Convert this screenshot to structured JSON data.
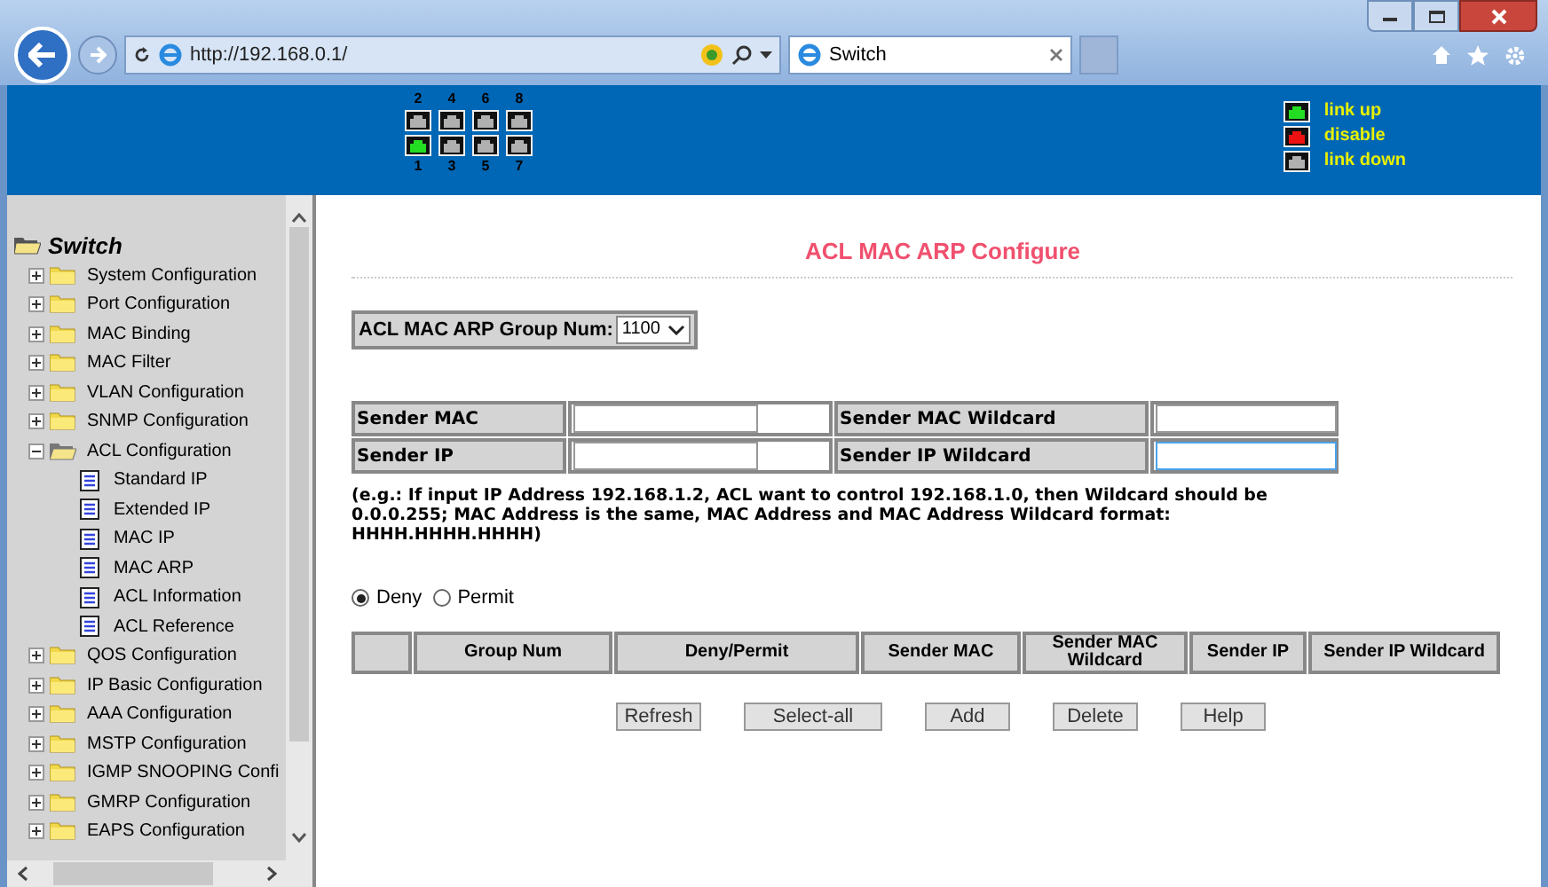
{
  "browser": {
    "url": "http://192.168.0.1/",
    "tab_title": "Switch"
  },
  "ports": {
    "top": [
      {
        "label": "2",
        "color": "#b0b0b0"
      },
      {
        "label": "4",
        "color": "#b0b0b0"
      },
      {
        "label": "6",
        "color": "#b0b0b0"
      },
      {
        "label": "8",
        "color": "#b0b0b0"
      }
    ],
    "bottom": [
      {
        "label": "1",
        "color": "#22dd22"
      },
      {
        "label": "3",
        "color": "#b0b0b0"
      },
      {
        "label": "5",
        "color": "#b0b0b0"
      },
      {
        "label": "7",
        "color": "#b0b0b0"
      }
    ]
  },
  "legend": [
    {
      "label": "link up",
      "color": "#22dd22"
    },
    {
      "label": "disable",
      "color": "#ee1111"
    },
    {
      "label": "link down",
      "color": "#b0b0b0"
    }
  ],
  "sidebar": {
    "root": "Switch",
    "items": [
      {
        "label": "System Configuration",
        "expanded": false
      },
      {
        "label": "Port Configuration",
        "expanded": false
      },
      {
        "label": "MAC Binding",
        "expanded": false
      },
      {
        "label": "MAC Filter",
        "expanded": false
      },
      {
        "label": "VLAN Configuration",
        "expanded": false
      },
      {
        "label": "SNMP Configuration",
        "expanded": false
      },
      {
        "label": "ACL Configuration",
        "expanded": true,
        "children": [
          {
            "label": "Standard IP"
          },
          {
            "label": "Extended IP"
          },
          {
            "label": "MAC IP"
          },
          {
            "label": "MAC ARP"
          },
          {
            "label": "ACL Information"
          },
          {
            "label": "ACL Reference"
          }
        ]
      },
      {
        "label": "QOS Configuration",
        "expanded": false
      },
      {
        "label": "IP Basic Configuration",
        "expanded": false
      },
      {
        "label": "AAA Configuration",
        "expanded": false
      },
      {
        "label": "MSTP Configuration",
        "expanded": false
      },
      {
        "label": "IGMP SNOOPING Confi",
        "expanded": false
      },
      {
        "label": "GMRP Configuration",
        "expanded": false
      },
      {
        "label": "EAPS Configuration",
        "expanded": false
      }
    ]
  },
  "form": {
    "title": "ACL MAC ARP Configure",
    "group_num": {
      "label": "ACL MAC ARP Group Num:",
      "value": "1100"
    },
    "fields": [
      {
        "label": "Sender MAC",
        "focused": false
      },
      {
        "label": "Sender MAC Wildcard",
        "focused": false
      },
      {
        "label": "Sender IP",
        "focused": false
      },
      {
        "label": "Sender IP Wildcard",
        "focused": true
      }
    ],
    "note": "(e.g.: If input IP Address 192.168.1.2, ACL want to control 192.168.1.0, then Wildcard should be 0.0.0.255; MAC Address is the same, MAC Address and MAC Address Wildcard format: HHHH.HHHH.HHHH)",
    "radios": [
      {
        "label": "Deny",
        "selected": true
      },
      {
        "label": "Permit",
        "selected": false
      }
    ],
    "table": {
      "columns": [
        "",
        "Group Num",
        "Deny/Permit",
        "Sender MAC",
        "Sender MAC Wildcard",
        "Sender IP",
        "Sender IP Wildcard"
      ]
    },
    "buttons": [
      "Refresh",
      "Select-all",
      "Add",
      "Delete",
      "Help"
    ]
  }
}
